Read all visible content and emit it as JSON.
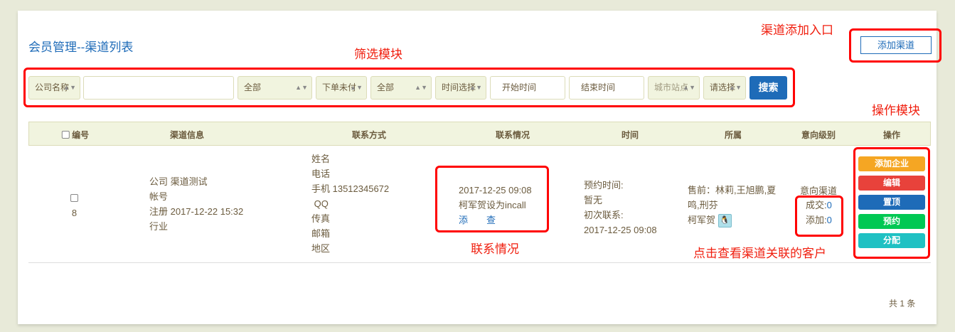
{
  "page": {
    "title": "会员管理--渠道列表",
    "add_button": "添加渠道",
    "footer_count": "共 1 条"
  },
  "annotations": {
    "add_entry": "渠道添加入口",
    "filter_module": "筛选模块",
    "op_module": "操作模块",
    "contact_status": "联系情况",
    "click_hint": "点击查看渠道关联的客户"
  },
  "filters": {
    "company_select": "公司名称",
    "company_input": "",
    "all_1": "全部",
    "order_status": "下单未付",
    "all_2": "全部",
    "time_select": "时间选择",
    "start_placeholder": "开始时间",
    "end_placeholder": "结束时间",
    "city": "城市站点",
    "please_select": "请选择",
    "search": "搜索"
  },
  "table": {
    "headers": [
      "编号",
      "渠道信息",
      "联系方式",
      "联系情况",
      "时间",
      "所属",
      "意向级别",
      "操作"
    ],
    "row": {
      "id": "8",
      "info": [
        "公司 渠道测试",
        "帐号",
        "注册 2017-12-22 15:32",
        "行业"
      ],
      "contact": [
        "姓名",
        "电话",
        "手机 13512345672",
        " QQ",
        "传真",
        "邮箱",
        "地区"
      ],
      "status_time": "2017-12-25 09:08",
      "status_text": "柯军贺设为incall",
      "add_link": "添",
      "view_link": "查",
      "time": [
        "预约时间:",
        "暂无",
        "初次联系:",
        "2017-12-25 09:08"
      ],
      "owner": [
        "售前：林莉,王旭鹏,夏",
        "鸣,刑芬",
        "柯军贺"
      ],
      "intent": "意向渠道",
      "deal_label": "成交:",
      "deal_count": "0",
      "added_label": "添加:",
      "added_count": "0"
    },
    "ops": [
      "添加企业",
      "编辑",
      "置顶",
      "预约",
      "分配"
    ]
  },
  "colors": {
    "primary": "#1e6bb8",
    "orange": "#f5a623",
    "red": "#e8423b",
    "green": "#00c853",
    "teal": "#1fc1c3"
  }
}
